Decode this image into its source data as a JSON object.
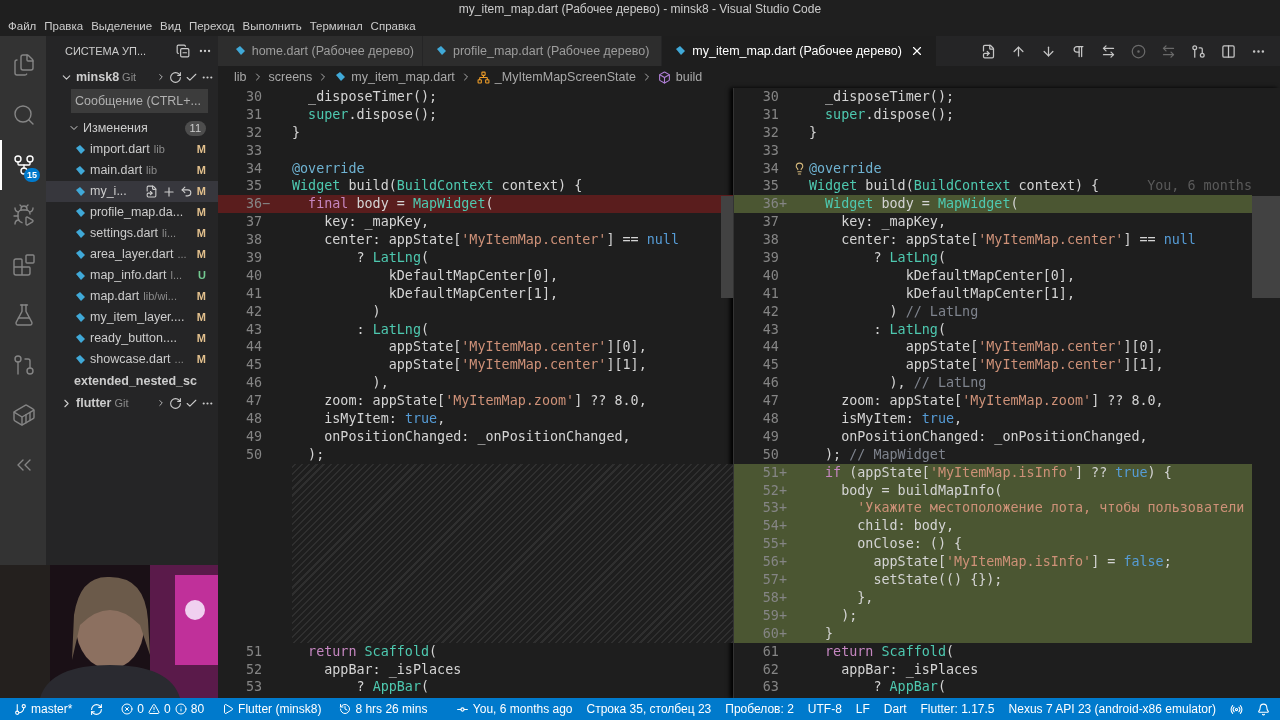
{
  "window": {
    "title": "my_item_map.dart (Рабочее дерево) - minsk8 - Visual Studio Code"
  },
  "menu": [
    "Файл",
    "Правка",
    "Выделение",
    "Вид",
    "Переход",
    "Выполнить",
    "Терминал",
    "Справка"
  ],
  "activity_bar": [
    {
      "kind": "explorer",
      "selected": false
    },
    {
      "kind": "search",
      "selected": false
    },
    {
      "kind": "scm",
      "selected": true,
      "badge": "15"
    },
    {
      "kind": "debug",
      "selected": false
    },
    {
      "kind": "extensions",
      "selected": false
    },
    {
      "kind": "testing",
      "selected": false
    },
    {
      "kind": "git-graph",
      "selected": false
    },
    {
      "kind": "docker",
      "selected": false
    },
    {
      "kind": "flutter",
      "selected": false
    }
  ],
  "sidebar": {
    "title": "СИСТЕМА УП...",
    "repo": {
      "name": "minsk8",
      "provider": "Git",
      "expanded": true,
      "message_placeholder": "Сообщение (CTRL+...",
      "changes": {
        "label": "Изменения",
        "count": "11",
        "expanded": true,
        "files": [
          {
            "name": "import.dart",
            "path": "lib",
            "status": "M",
            "kind": "modified",
            "selected": false
          },
          {
            "name": "main.dart",
            "path": "lib",
            "status": "M",
            "kind": "modified",
            "selected": false
          },
          {
            "name": "my_i...",
            "status": "M",
            "kind": "modified",
            "selected": true
          },
          {
            "name": "profile_map.da...",
            "status": "M",
            "kind": "modified",
            "selected": false
          },
          {
            "name": "settings.dart",
            "path": "li...",
            "status": "M",
            "kind": "modified",
            "selected": false
          },
          {
            "name": "area_layer.dart",
            "path": "...",
            "status": "M",
            "kind": "modified",
            "selected": false
          },
          {
            "name": "map_info.dart",
            "path": "l...",
            "status": "U",
            "kind": "untracked",
            "selected": false
          },
          {
            "name": "map.dart",
            "path": "lib/wi...",
            "status": "M",
            "kind": "modified",
            "selected": false
          },
          {
            "name": "my_item_layer....",
            "status": "M",
            "kind": "modified",
            "selected": false
          },
          {
            "name": "ready_button....",
            "status": "M",
            "kind": "modified",
            "selected": false
          },
          {
            "name": "showcase.dart",
            "path": "...",
            "status": "M",
            "kind": "modified",
            "selected": false
          }
        ]
      }
    },
    "folder_label": "extended_nested_sc",
    "collapsed_repo": {
      "name": "flutter",
      "provider": "Git",
      "expanded": false
    }
  },
  "tabs": [
    {
      "label": "home.dart (Рабочее дерево)",
      "selected": false
    },
    {
      "label": "profile_map.dart (Рабочее дерево)",
      "selected": false
    },
    {
      "label": "my_item_map.dart (Рабочее дерево)",
      "selected": true
    }
  ],
  "breadcrumbs": [
    {
      "text": "lib",
      "kind": "folder"
    },
    {
      "text": "screens",
      "kind": "folder"
    },
    {
      "text": "my_item_map.dart",
      "kind": "file"
    },
    {
      "text": "_MyItemMapScreenState",
      "kind": "class"
    },
    {
      "text": "build",
      "kind": "method"
    }
  ],
  "left_pane": [
    {
      "kind": "line",
      "num": "30",
      "tokens": [
        {
          "text": "  _disposeTimer();",
          "kind": "plain"
        }
      ]
    },
    {
      "kind": "line",
      "num": "31",
      "tokens": [
        {
          "text": "  super",
          "kind": "type"
        },
        {
          "text": ".dispose();",
          "kind": "plain"
        }
      ]
    },
    {
      "kind": "line",
      "num": "32",
      "tokens": [
        {
          "text": "}",
          "kind": "plain"
        }
      ]
    },
    {
      "kind": "line",
      "num": "33"
    },
    {
      "kind": "line",
      "num": "34",
      "tokens": [
        {
          "text": "@override",
          "kind": "annotation"
        }
      ]
    },
    {
      "kind": "line",
      "num": "35",
      "tokens": [
        {
          "text": "Widget",
          "kind": "type"
        },
        {
          "text": " build(",
          "kind": "plain"
        },
        {
          "text": "BuildContext",
          "kind": "type"
        },
        {
          "text": " context) {",
          "kind": "plain"
        }
      ]
    },
    {
      "kind": "removed",
      "num": "36",
      "sign": "−",
      "tokens": [
        {
          "text": "  final",
          "kind": "keyword"
        },
        {
          "text": " body = ",
          "kind": "plain"
        },
        {
          "text": "MapWidget",
          "kind": "type"
        },
        {
          "text": "(",
          "kind": "plain"
        }
      ]
    },
    {
      "kind": "line",
      "num": "37",
      "tokens": [
        {
          "text": "    key: _mapKey,",
          "kind": "plain"
        }
      ]
    },
    {
      "kind": "line",
      "num": "38",
      "tokens": [
        {
          "text": "    center: appState[",
          "kind": "plain"
        },
        {
          "text": "'MyItemMap.center'",
          "kind": "string"
        },
        {
          "text": "] == ",
          "kind": "plain"
        },
        {
          "text": "null",
          "kind": "literal"
        }
      ]
    },
    {
      "kind": "line",
      "num": "39",
      "tokens": [
        {
          "text": "        ? ",
          "kind": "plain"
        },
        {
          "text": "LatLng",
          "kind": "type"
        },
        {
          "text": "(",
          "kind": "plain"
        }
      ]
    },
    {
      "kind": "line",
      "num": "40",
      "tokens": [
        {
          "text": "            kDefaultMapCenter[0],",
          "kind": "plain"
        }
      ]
    },
    {
      "kind": "line",
      "num": "41",
      "tokens": [
        {
          "text": "            kDefaultMapCenter[1],",
          "kind": "plain"
        }
      ]
    },
    {
      "kind": "line",
      "num": "42",
      "tokens": [
        {
          "text": "          )",
          "kind": "plain"
        }
      ]
    },
    {
      "kind": "line",
      "num": "43",
      "tokens": [
        {
          "text": "        : ",
          "kind": "plain"
        },
        {
          "text": "LatLng",
          "kind": "type"
        },
        {
          "text": "(",
          "kind": "plain"
        }
      ]
    },
    {
      "kind": "line",
      "num": "44",
      "tokens": [
        {
          "text": "            appState[",
          "kind": "plain"
        },
        {
          "text": "'MyItemMap.center'",
          "kind": "string"
        },
        {
          "text": "][0],",
          "kind": "plain"
        }
      ]
    },
    {
      "kind": "line",
      "num": "45",
      "tokens": [
        {
          "text": "            appState[",
          "kind": "plain"
        },
        {
          "text": "'MyItemMap.center'",
          "kind": "string"
        },
        {
          "text": "][1],",
          "kind": "plain"
        }
      ]
    },
    {
      "kind": "line",
      "num": "46",
      "tokens": [
        {
          "text": "          ),",
          "kind": "plain"
        }
      ]
    },
    {
      "kind": "line",
      "num": "47",
      "tokens": [
        {
          "text": "    zoom: appState[",
          "kind": "plain"
        },
        {
          "text": "'MyItemMap.zoom'",
          "kind": "string"
        },
        {
          "text": "] ?? 8.0,",
          "kind": "plain"
        }
      ]
    },
    {
      "kind": "line",
      "num": "48",
      "tokens": [
        {
          "text": "    isMyItem: ",
          "kind": "plain"
        },
        {
          "text": "true",
          "kind": "literal"
        },
        {
          "text": ",",
          "kind": "plain"
        }
      ]
    },
    {
      "kind": "line",
      "num": "49",
      "tokens": [
        {
          "text": "    onPositionChanged: _onPositionChanged,",
          "kind": "plain"
        }
      ]
    },
    {
      "kind": "line",
      "num": "50",
      "tokens": [
        {
          "text": "  );",
          "kind": "plain"
        }
      ]
    },
    {
      "kind": "gap"
    },
    {
      "kind": "line",
      "num": "51",
      "tokens": [
        {
          "text": "  return",
          "kind": "keyword"
        },
        {
          "text": " Scaffold",
          "kind": "type"
        },
        {
          "text": "(",
          "kind": "plain"
        }
      ]
    },
    {
      "kind": "line",
      "num": "52",
      "tokens": [
        {
          "text": "    appBar: _isPlaces",
          "kind": "plain"
        }
      ]
    },
    {
      "kind": "line",
      "num": "53",
      "tokens": [
        {
          "text": "        ? ",
          "kind": "plain"
        },
        {
          "text": "AppBar",
          "kind": "type"
        },
        {
          "text": "(",
          "kind": "plain"
        }
      ]
    }
  ],
  "right_pane": [
    {
      "kind": "line",
      "num": "30",
      "tokens": [
        {
          "text": "  _disposeTimer();",
          "kind": "plain"
        }
      ]
    },
    {
      "kind": "line",
      "num": "31",
      "tokens": [
        {
          "text": "  super",
          "kind": "type"
        },
        {
          "text": ".dispose();",
          "kind": "plain"
        }
      ]
    },
    {
      "kind": "line",
      "num": "32",
      "tokens": [
        {
          "text": "}",
          "kind": "plain"
        }
      ]
    },
    {
      "kind": "line",
      "num": "33"
    },
    {
      "kind": "line",
      "num": "34",
      "lightbulb": true,
      "tokens": [
        {
          "text": "@override",
          "kind": "annotation"
        }
      ]
    },
    {
      "kind": "line",
      "num": "35",
      "blame": "You, 6 months",
      "tokens": [
        {
          "text": "Widget",
          "kind": "type"
        },
        {
          "text": " build(",
          "kind": "plain"
        },
        {
          "text": "BuildContext",
          "kind": "type"
        },
        {
          "text": " context) {",
          "kind": "plain"
        }
      ]
    },
    {
      "kind": "added",
      "num": "36",
      "sign": "+",
      "tokens": [
        {
          "text": "  Widget",
          "kind": "type"
        },
        {
          "text": " body = ",
          "kind": "plain"
        },
        {
          "text": "MapWidget",
          "kind": "type"
        },
        {
          "text": "(",
          "kind": "plain"
        }
      ]
    },
    {
      "kind": "line",
      "num": "37",
      "tokens": [
        {
          "text": "    key: _mapKey,",
          "kind": "plain"
        }
      ]
    },
    {
      "kind": "line",
      "num": "38",
      "tokens": [
        {
          "text": "    center: appState[",
          "kind": "plain"
        },
        {
          "text": "'MyItemMap.center'",
          "kind": "string"
        },
        {
          "text": "] == ",
          "kind": "plain"
        },
        {
          "text": "null",
          "kind": "literal"
        }
      ]
    },
    {
      "kind": "line",
      "num": "39",
      "tokens": [
        {
          "text": "        ? ",
          "kind": "plain"
        },
        {
          "text": "LatLng",
          "kind": "type"
        },
        {
          "text": "(",
          "kind": "plain"
        }
      ]
    },
    {
      "kind": "line",
      "num": "40",
      "tokens": [
        {
          "text": "            kDefaultMapCenter[0],",
          "kind": "plain"
        }
      ]
    },
    {
      "kind": "line",
      "num": "41",
      "tokens": [
        {
          "text": "            kDefaultMapCenter[1],",
          "kind": "plain"
        }
      ]
    },
    {
      "kind": "line",
      "num": "42",
      "tokens": [
        {
          "text": "          ) ",
          "kind": "plain"
        },
        {
          "text": "// LatLng",
          "kind": "comment"
        }
      ]
    },
    {
      "kind": "line",
      "num": "43",
      "tokens": [
        {
          "text": "        : ",
          "kind": "plain"
        },
        {
          "text": "LatLng",
          "kind": "type"
        },
        {
          "text": "(",
          "kind": "plain"
        }
      ]
    },
    {
      "kind": "line",
      "num": "44",
      "tokens": [
        {
          "text": "            appState[",
          "kind": "plain"
        },
        {
          "text": "'MyItemMap.center'",
          "kind": "string"
        },
        {
          "text": "][0],",
          "kind": "plain"
        }
      ]
    },
    {
      "kind": "line",
      "num": "45",
      "tokens": [
        {
          "text": "            appState[",
          "kind": "plain"
        },
        {
          "text": "'MyItemMap.center'",
          "kind": "string"
        },
        {
          "text": "][1],",
          "kind": "plain"
        }
      ]
    },
    {
      "kind": "line",
      "num": "46",
      "tokens": [
        {
          "text": "          ), ",
          "kind": "plain"
        },
        {
          "text": "// LatLng",
          "kind": "comment"
        }
      ]
    },
    {
      "kind": "line",
      "num": "47",
      "tokens": [
        {
          "text": "    zoom: appState[",
          "kind": "plain"
        },
        {
          "text": "'MyItemMap.zoom'",
          "kind": "string"
        },
        {
          "text": "] ?? 8.0,",
          "kind": "plain"
        }
      ]
    },
    {
      "kind": "line",
      "num": "48",
      "tokens": [
        {
          "text": "    isMyItem: ",
          "kind": "plain"
        },
        {
          "text": "true",
          "kind": "literal"
        },
        {
          "text": ",",
          "kind": "plain"
        }
      ]
    },
    {
      "kind": "line",
      "num": "49",
      "tokens": [
        {
          "text": "    onPositionChanged: _onPositionChanged,",
          "kind": "plain"
        }
      ]
    },
    {
      "kind": "line",
      "num": "50",
      "tokens": [
        {
          "text": "  ); ",
          "kind": "plain"
        },
        {
          "text": "// MapWidget",
          "kind": "comment"
        }
      ]
    },
    {
      "kind": "added",
      "num": "51",
      "sign": "+",
      "tokens": [
        {
          "text": "  if",
          "kind": "keyword"
        },
        {
          "text": " (appState[",
          "kind": "plain"
        },
        {
          "text": "'MyItemMap.isInfo'",
          "kind": "string"
        },
        {
          "text": "] ?? ",
          "kind": "plain"
        },
        {
          "text": "true",
          "kind": "literal"
        },
        {
          "text": ") {",
          "kind": "plain"
        }
      ]
    },
    {
      "kind": "added",
      "num": "52",
      "sign": "+",
      "tokens": [
        {
          "text": "    body = buildMapInfo(",
          "kind": "plain"
        }
      ]
    },
    {
      "kind": "added",
      "num": "53",
      "sign": "+",
      "tokens": [
        {
          "text": "      'Укажите местоположение лота, чтобы пользователи",
          "kind": "string"
        }
      ]
    },
    {
      "kind": "added",
      "num": "54",
      "sign": "+",
      "tokens": [
        {
          "text": "      child: body,",
          "kind": "plain"
        }
      ]
    },
    {
      "kind": "added",
      "num": "55",
      "sign": "+",
      "tokens": [
        {
          "text": "      onClose: () {",
          "kind": "plain"
        }
      ]
    },
    {
      "kind": "added",
      "num": "56",
      "sign": "+",
      "tokens": [
        {
          "text": "        appState[",
          "kind": "plain"
        },
        {
          "text": "'MyItemMap.isInfo'",
          "kind": "string"
        },
        {
          "text": "] = ",
          "kind": "plain"
        },
        {
          "text": "false",
          "kind": "literal"
        },
        {
          "text": ";",
          "kind": "plain"
        }
      ]
    },
    {
      "kind": "added",
      "num": "57",
      "sign": "+",
      "tokens": [
        {
          "text": "        setState(() {});",
          "kind": "plain"
        }
      ]
    },
    {
      "kind": "added",
      "num": "58",
      "sign": "+",
      "tokens": [
        {
          "text": "      },",
          "kind": "plain"
        }
      ]
    },
    {
      "kind": "added",
      "num": "59",
      "sign": "+",
      "tokens": [
        {
          "text": "    );",
          "kind": "plain"
        }
      ]
    },
    {
      "kind": "added",
      "num": "60",
      "sign": "+",
      "tokens": [
        {
          "text": "  }",
          "kind": "plain"
        }
      ]
    },
    {
      "kind": "line",
      "num": "61",
      "tokens": [
        {
          "text": "  return",
          "kind": "keyword"
        },
        {
          "text": " Scaffold",
          "kind": "type"
        },
        {
          "text": "(",
          "kind": "plain"
        }
      ]
    },
    {
      "kind": "line",
      "num": "62",
      "tokens": [
        {
          "text": "    appBar: _isPlaces",
          "kind": "plain"
        }
      ]
    },
    {
      "kind": "line",
      "num": "63",
      "tokens": [
        {
          "text": "        ? ",
          "kind": "plain"
        },
        {
          "text": "AppBar",
          "kind": "type"
        },
        {
          "text": "(",
          "kind": "plain"
        }
      ]
    }
  ],
  "webcam": {
    "kind": "picture"
  },
  "status_bar": {
    "left": [
      {
        "kind": "branch",
        "text": "master*"
      },
      {
        "kind": "sync"
      },
      {
        "kind": "problems",
        "errors": "0",
        "warnings": "0",
        "infos": "80"
      },
      {
        "kind": "run",
        "text": "Flutter (minsk8)"
      },
      {
        "kind": "timer",
        "text": "8 hrs 26 mins"
      }
    ],
    "right": [
      {
        "kind": "blame",
        "text": "You, 6 months ago"
      },
      {
        "kind": "text",
        "text": "Строка 35, столбец 23"
      },
      {
        "kind": "text",
        "text": "Пробелов: 2"
      },
      {
        "kind": "text",
        "text": "UTF-8"
      },
      {
        "kind": "text",
        "text": "LF"
      },
      {
        "kind": "text",
        "text": "Dart"
      },
      {
        "kind": "text",
        "text": "Flutter: 1.17.5"
      },
      {
        "kind": "text",
        "text": "Nexus 7 API 23 (android-x86 emulator)"
      },
      {
        "kind": "broadcast"
      },
      {
        "kind": "bell"
      }
    ]
  }
}
